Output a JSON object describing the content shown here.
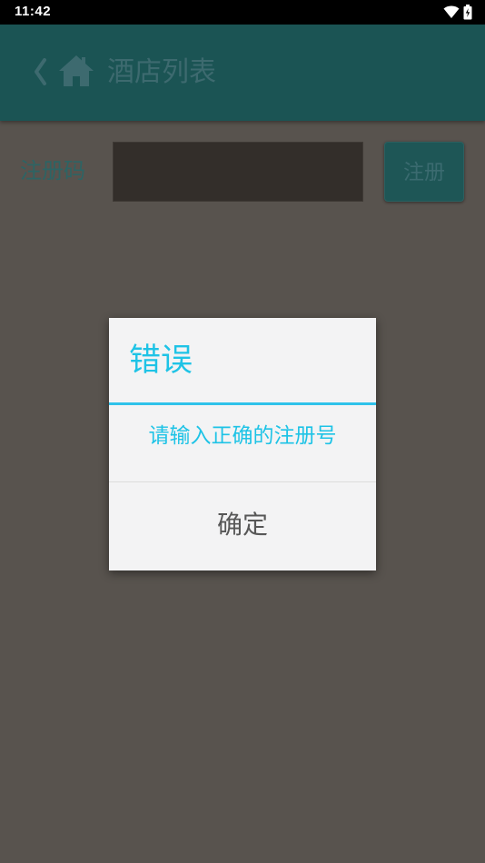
{
  "status_bar": {
    "time": "11:42",
    "icons": [
      "wifi-icon",
      "battery-charging-icon"
    ]
  },
  "app_bar": {
    "back_icon": "chevron-left-icon",
    "home_icon": "home-icon",
    "title": "酒店列表"
  },
  "form": {
    "label": "注册码",
    "input_value": "",
    "input_placeholder": "",
    "button_label": "注册"
  },
  "dialog": {
    "title": "错误",
    "message": "请输入正确的注册号",
    "ok_label": "确定"
  },
  "colors": {
    "app_bar": "#1b5454",
    "dim_background": "#58534e",
    "dialog_background": "#f3f3f4",
    "accent": "#1ec3e6"
  }
}
